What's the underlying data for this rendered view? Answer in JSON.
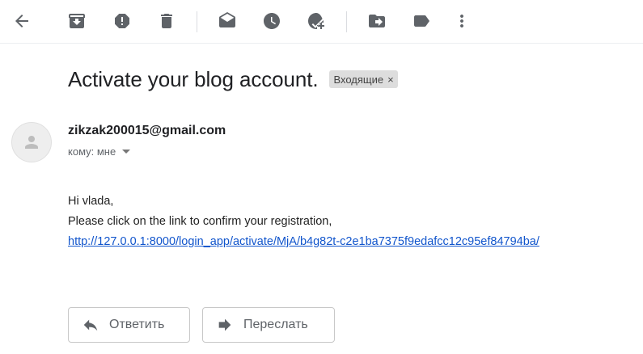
{
  "toolbar": {
    "icons": [
      "back-arrow-icon",
      "archive-icon",
      "report-spam-icon",
      "delete-icon",
      "mark-unread-icon",
      "snooze-icon",
      "add-to-tasks-icon",
      "move-to-icon",
      "labels-icon",
      "more-vert-icon"
    ]
  },
  "message": {
    "subject": "Activate your blog account.",
    "label": "Входящие",
    "label_close": "×",
    "sender": "zikzak200015@gmail.com",
    "recipient": "кому: мне",
    "body": {
      "greeting": "Hi vlada,",
      "line1": "Please click on the link to confirm your registration,",
      "link": "http://127.0.0.1:8000/login_app/activate/MjA/b4g82t-c2e1ba7375f9edafcc12c95ef84794ba/"
    }
  },
  "actions": {
    "reply_label": "Ответить",
    "forward_label": "Переслать"
  },
  "colors": {
    "link": "#1155cc",
    "icon": "#5f6368",
    "chip_bg": "#dddddd"
  }
}
